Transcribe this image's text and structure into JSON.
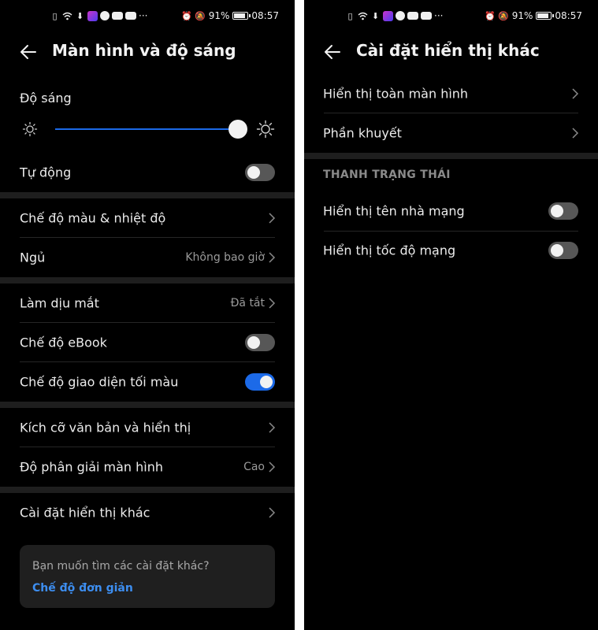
{
  "status_bar": {
    "battery_text": "91%",
    "battery_level": 0.91,
    "time": "08:57",
    "ellipsis": "···"
  },
  "left_screen": {
    "title": "Màn hình và độ sáng",
    "brightness": {
      "label": "Độ sáng",
      "value": 0.99
    },
    "auto": {
      "label": "Tự động",
      "on": false
    },
    "color_temp": {
      "label": "Chế độ màu & nhiệt độ"
    },
    "sleep": {
      "label": "Ngủ",
      "value": "Không bao giờ"
    },
    "eye_comfort": {
      "label": "Làm dịu mắt",
      "value": "Đã tắt"
    },
    "ebook": {
      "label": "Chế độ eBook",
      "on": false
    },
    "dark_mode": {
      "label": "Chế độ giao diện tối màu",
      "on": true
    },
    "text_size": {
      "label": "Kích cỡ văn bản và hiển thị"
    },
    "resolution": {
      "label": "Độ phân giải màn hình",
      "value": "Cao"
    },
    "more_settings": {
      "label": "Cài đặt hiển thị khác"
    },
    "tip": {
      "question": "Bạn muốn tìm các cài đặt khác?",
      "link": "Chế độ đơn giản"
    }
  },
  "right_screen": {
    "title": "Cài đặt hiển thị khác",
    "fullscreen": {
      "label": "Hiển thị toàn màn hình"
    },
    "notch": {
      "label": "Phần khuyết"
    },
    "section_status_bar": "THANH TRẠNG THÁI",
    "carrier_name": {
      "label": "Hiển thị tên nhà mạng",
      "on": false
    },
    "network_speed": {
      "label": "Hiển thị tốc độ mạng",
      "on": false
    }
  },
  "colors": {
    "background": "#000000",
    "accent": "#1c6ae8",
    "link": "#3d8ef0",
    "separator_band": "#1e1e1e"
  }
}
